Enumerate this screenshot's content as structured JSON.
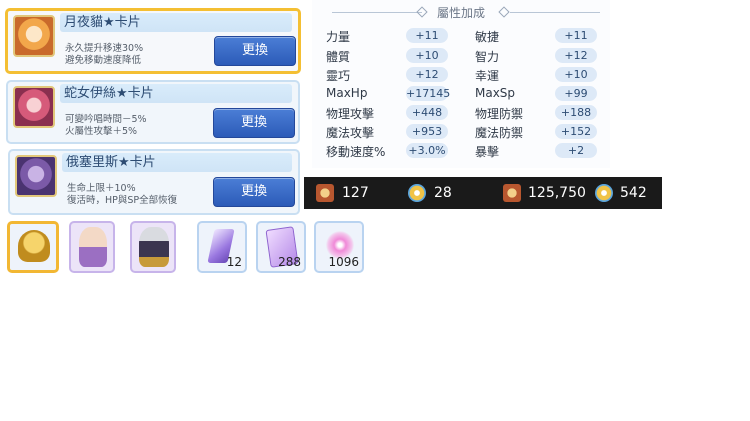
{
  "cards": [
    {
      "title": "月夜貓★卡片",
      "desc": "永久提升移速30%\n避免移動速度降低",
      "button": "更換",
      "selected": true
    },
    {
      "title": "蛇女伊絲★卡片",
      "desc": "可變吟唱時間－5%\n火屬性攻擊＋5%",
      "button": "更換",
      "selected": false
    },
    {
      "title": "俄塞里斯★卡片",
      "desc": "生命上限＋10%\n復活時，HP與SP全部恢復",
      "button": "更換",
      "selected": false
    }
  ],
  "stats": {
    "header": "屬性加成",
    "left": [
      {
        "label": "力量",
        "value": "+11"
      },
      {
        "label": "體質",
        "value": "+10"
      },
      {
        "label": "靈巧",
        "value": "+12"
      },
      {
        "label": "MaxHp",
        "value": "+17145"
      },
      {
        "label": "物理攻擊",
        "value": "+448"
      },
      {
        "label": "魔法攻擊",
        "value": "+953"
      },
      {
        "label": "移動速度%",
        "value": "+3.0%"
      }
    ],
    "right": [
      {
        "label": "敏捷",
        "value": "+11"
      },
      {
        "label": "智力",
        "value": "+12"
      },
      {
        "label": "幸運",
        "value": "+10"
      },
      {
        "label": "MaxSp",
        "value": "+99"
      },
      {
        "label": "物理防禦",
        "value": "+188"
      },
      {
        "label": "魔法防禦",
        "value": "+152"
      },
      {
        "label": "暴擊",
        "value": "+2"
      }
    ]
  },
  "resources": [
    {
      "icon": "medal-icon",
      "value": "127"
    },
    {
      "icon": "gem-crystal-icon",
      "value": "28"
    },
    {
      "icon": "medal-locked-icon",
      "value": "125,750"
    },
    {
      "icon": "gem-crystal-locked-icon",
      "value": "542"
    }
  ],
  "inventory": [
    {
      "icon": "golden-helmet-icon",
      "count": ""
    },
    {
      "icon": "old-sage-portrait-icon",
      "count": ""
    },
    {
      "icon": "dark-knight-portrait-icon",
      "count": ""
    },
    {
      "icon": "purple-crystal-icon",
      "count": "12"
    },
    {
      "icon": "purple-card-icon",
      "count": "288"
    },
    {
      "icon": "pink-orb-icon",
      "count": "1096"
    }
  ]
}
